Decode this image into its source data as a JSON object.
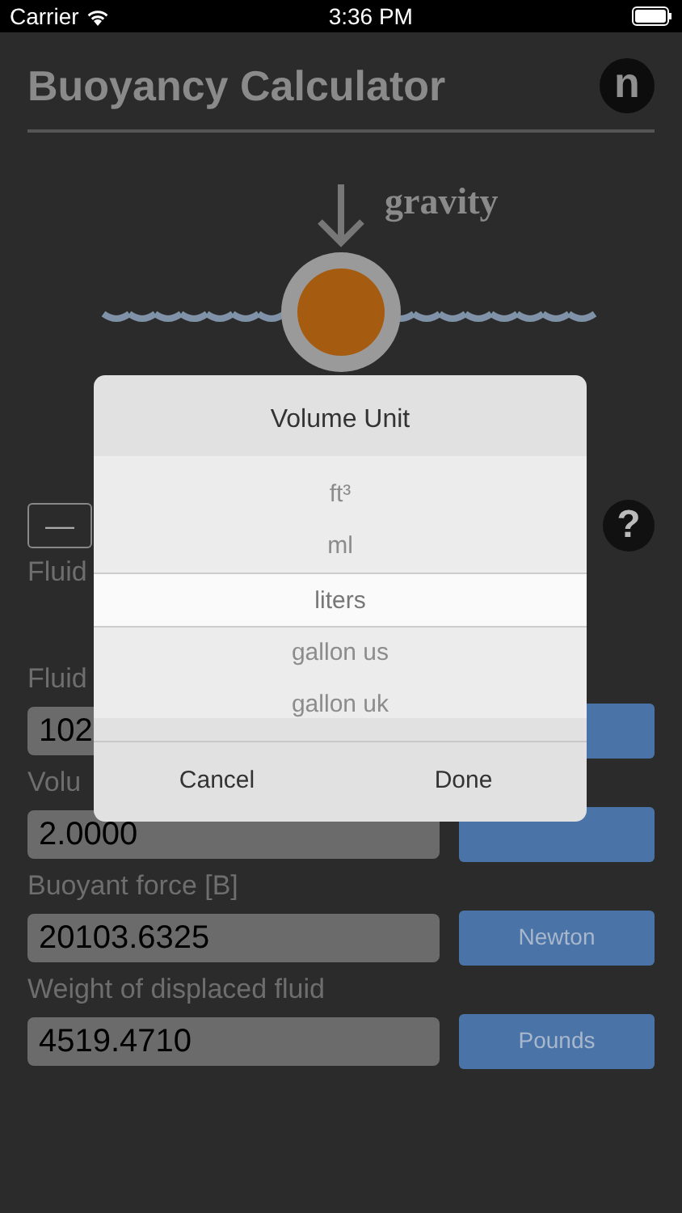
{
  "status_bar": {
    "carrier": "Carrier",
    "time": "3:36 PM"
  },
  "header": {
    "title": "Buoyancy Calculator",
    "logo": "n"
  },
  "diagram": {
    "force_label": "gravity"
  },
  "toolbar": {
    "minus_button": "—",
    "help_button": "?"
  },
  "rows": [
    {
      "kind": "label",
      "label": "Fluid"
    },
    {
      "kind": "field",
      "label": "Fluid",
      "value": "102"
    },
    {
      "kind": "field",
      "label": "Volu",
      "value": "2.0000"
    },
    {
      "kind": "field",
      "label": "Buoyant force [B]",
      "value": "20103.6325",
      "unit": "Newton"
    },
    {
      "kind": "field",
      "label": "Weight of displaced fluid",
      "value": "4519.4710",
      "unit": "Pounds"
    }
  ],
  "dialog": {
    "title": "Volume Unit",
    "options": [
      {
        "label": "ft³",
        "selected": false
      },
      {
        "label": "ml",
        "selected": false
      },
      {
        "label": "liters",
        "selected": true
      },
      {
        "label": "gallon us",
        "selected": false
      },
      {
        "label": "gallon uk",
        "selected": false
      }
    ],
    "buttons": [
      "Cancel",
      "Done"
    ]
  }
}
